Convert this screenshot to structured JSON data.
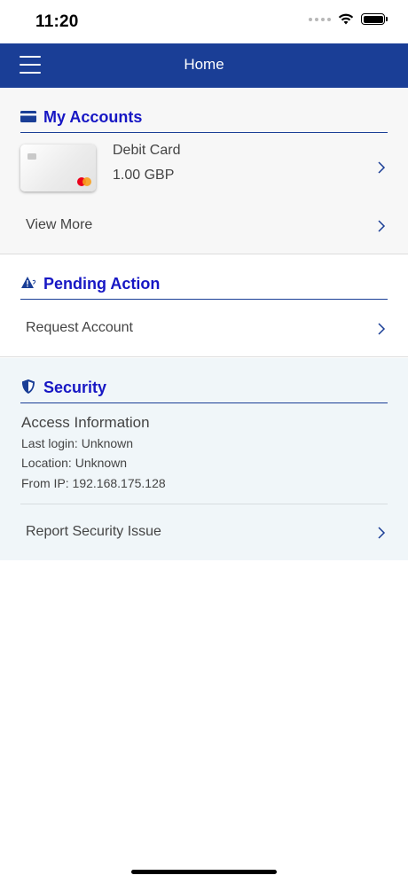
{
  "status_bar": {
    "time": "11:20"
  },
  "navbar": {
    "title": "Home"
  },
  "accounts": {
    "title": "My Accounts",
    "card": {
      "name": "Debit Card",
      "amount": "1.00 GBP"
    },
    "view_more": "View More"
  },
  "pending": {
    "title": "Pending Action",
    "request_account": "Request Account"
  },
  "security": {
    "title": "Security",
    "access_title": "Access Information",
    "last_login": "Last login: Unknown",
    "location": "Location: Unknown",
    "from_ip": "From IP: 192.168.175.128",
    "report": "Report Security Issue"
  },
  "colors": {
    "navbar": "#1a3e96",
    "section_title": "#1717c4",
    "accounts_bg": "#f7f7f7",
    "security_bg": "#f0f6f9"
  },
  "icons": {
    "menu": "hamburger-icon",
    "accounts": "credit-card-icon",
    "pending": "warning-triangle-icon",
    "security": "shield-icon",
    "chevron": "chevron-right-icon"
  }
}
